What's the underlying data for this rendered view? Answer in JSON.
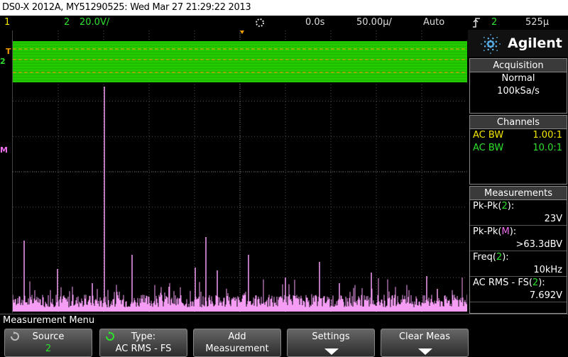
{
  "title_bar": {
    "text": "DS0-X 2012A, MY51290525: Wed Mar 27 21:29:22 2013"
  },
  "status_bar": {
    "ch1_label": "1",
    "ch2_label": "2",
    "ch2_scale": "20.0V/",
    "time_delay": "0.0s",
    "time_scale": "50.00µ/",
    "trigger_mode": "Auto",
    "trigger_icon": "trigger-edge-icon",
    "trigger_source": "2",
    "trigger_level": "525µ"
  },
  "brand": {
    "name": "Agilent",
    "logo": "agilent-spark-logo"
  },
  "acquisition": {
    "header": "Acquisition",
    "mode": "Normal",
    "rate": "100kSa/s"
  },
  "channels": {
    "header": "Channels",
    "items": [
      {
        "name": "AC BW",
        "value": "1.00:1",
        "color": "#f5e800"
      },
      {
        "name": "AC BW",
        "value": "10.0:1",
        "color": "#2ee02e"
      }
    ]
  },
  "measurements": {
    "header": "Measurements",
    "items": [
      {
        "label_prefix": "Pk-Pk(",
        "source": "2",
        "label_suffix": "):",
        "value": "23V",
        "source_color": "#2ee02e"
      },
      {
        "label_prefix": "Pk-Pk(",
        "source": "M",
        "label_suffix": "):",
        "value": ">63.3dBV",
        "source_color": "#f070f0"
      },
      {
        "label_prefix": "Freq(",
        "source": "2",
        "label_suffix": "):",
        "value": "10kHz",
        "source_color": "#2ee02e"
      },
      {
        "label_prefix": "AC RMS - FS(",
        "source": "2",
        "label_suffix": "):",
        "value": "7.692V",
        "source_color": "#2ee02e"
      }
    ]
  },
  "waveform": {
    "ch2_color": "#22cc00",
    "math_color": "#f59cf5",
    "ch2_marker": "2",
    "trigger_marker": "T",
    "math_marker": "M"
  },
  "menu": {
    "title": "Measurement Menu"
  },
  "softkeys": [
    {
      "line1": "Source",
      "line2": "2",
      "icon": "rotary-knob-icon"
    },
    {
      "line1": "Type:",
      "line2": "AC RMS - FS",
      "icon": "rotary-knob-icon"
    },
    {
      "line1": "Add",
      "line2": "Measurement",
      "icon": ""
    },
    {
      "line1": "Settings",
      "line2": "",
      "icon": "submenu-arrow-icon"
    },
    {
      "line1": "Clear Meas",
      "line2": "",
      "icon": "submenu-arrow-icon"
    }
  ]
}
